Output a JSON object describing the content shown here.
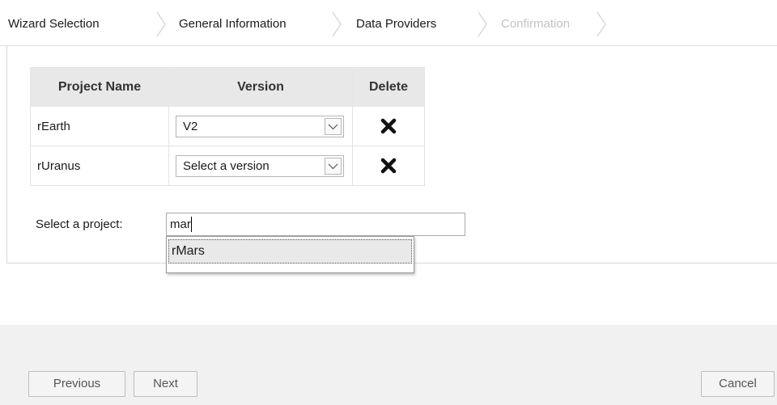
{
  "breadcrumb": {
    "steps": [
      {
        "label": "Wizard Selection",
        "state": "enabled"
      },
      {
        "label": "General Information",
        "state": "enabled"
      },
      {
        "label": "Data Providers",
        "state": "enabled"
      },
      {
        "label": "Confirmation",
        "state": "disabled"
      }
    ]
  },
  "table": {
    "headers": [
      "Project Name",
      "Version",
      "Delete"
    ],
    "rows": [
      {
        "project": "rEarth",
        "version": "V2"
      },
      {
        "project": "rUranus",
        "version": "Select a version"
      }
    ]
  },
  "picker": {
    "label": "Select a project:",
    "value": "mar",
    "suggestions": [
      "rMars"
    ]
  },
  "footer": {
    "previous_label": "Previous",
    "next_label": "Next",
    "cancel_label": "Cancel"
  },
  "icons": {
    "delete": "delete-x-icon",
    "dropdown": "chevron-down-icon",
    "separator": "chevron-right-icon"
  },
  "colors": {
    "header_bg": "#e8e8e8",
    "footer_bg": "#f1f1f1",
    "disabled_text": "#c2c2c2"
  }
}
